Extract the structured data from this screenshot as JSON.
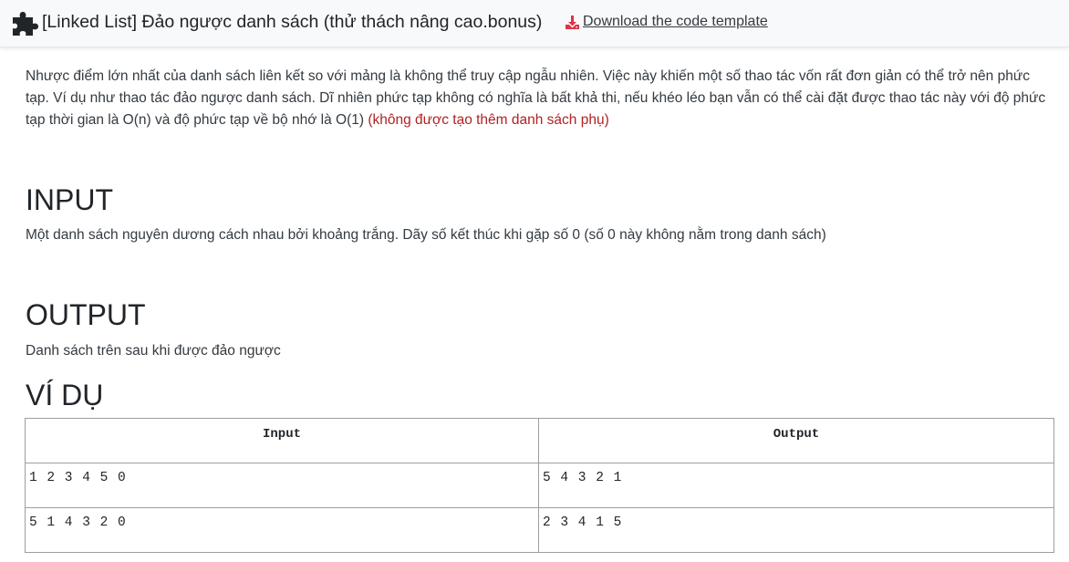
{
  "header": {
    "title": "[Linked List] Đảo ngược danh sách (thử thách nâng cao.bonus)",
    "title_icon": "puzzle-piece-icon",
    "download_label": "Download the code template",
    "download_icon": "download-icon",
    "download_icon_color": "#dc3545"
  },
  "intro": {
    "text": "Nhược điểm lớn nhất của danh sách liên kết so với mảng là không thể truy cập ngẫu nhiên. Việc này khiến một số thao tác vốn rất đơn giản có thể trở nên phức tạp. Ví dụ như thao tác đảo ngược danh sách. Dĩ nhiên phức tạp không có nghĩa là bất khả thi, nếu khéo léo bạn vẫn có thể cài đặt được thao tác này với độ phức tạp thời gian là O(n) và độ phức tạp về bộ nhớ là O(1) ",
    "warning": "(không được tạo thêm danh sách phụ)",
    "warning_color": "#b22222"
  },
  "input_section": {
    "heading": "INPUT",
    "text": "Một danh sách nguyên dương cách nhau bởi khoảng trắng. Dãy số kết thúc khi gặp số 0 (số 0 này không nằm trong danh sách)"
  },
  "output_section": {
    "heading": "OUTPUT",
    "text": "Danh sách trên sau khi được đảo ngược"
  },
  "examples": {
    "heading": "VÍ DỤ",
    "columns": [
      "Input",
      "Output"
    ],
    "rows": [
      {
        "input": "1 2 3 4 5 0",
        "output": "5 4 3 2 1"
      },
      {
        "input": "5 1 4 3 2 0",
        "output": "2 3 4 1 5"
      }
    ]
  }
}
